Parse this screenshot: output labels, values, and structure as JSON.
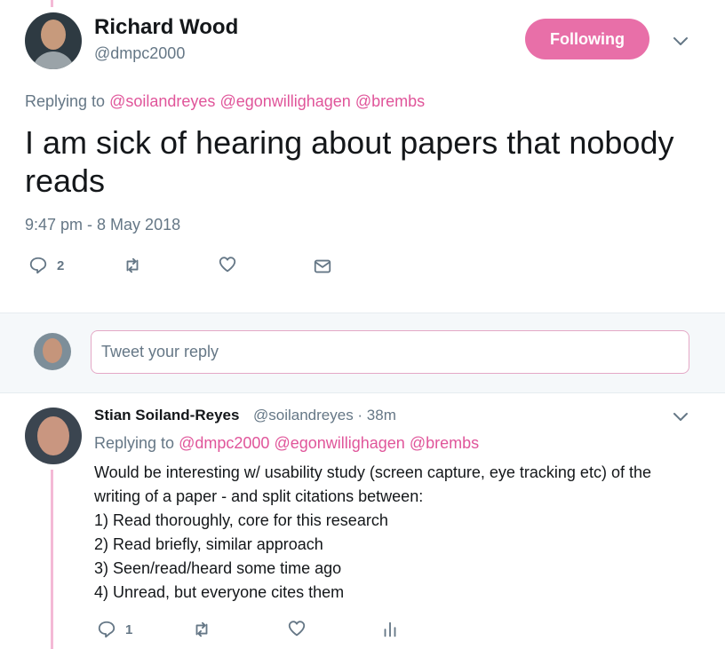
{
  "main_tweet": {
    "display_name": "Richard Wood",
    "handle": "@dmpc2000",
    "follow_label": "Following",
    "replying_prefix": "Replying to",
    "replying_mentions": [
      "@soilandreyes",
      "@egonwillighagen",
      "@brembs"
    ],
    "text": "I am sick of hearing about papers that nobody reads",
    "timestamp": "9:47 pm - 8 May 2018",
    "actions": {
      "reply_count": "2"
    }
  },
  "compose": {
    "placeholder": "Tweet your reply"
  },
  "reply_tweet": {
    "display_name": "Stian Soiland-Reyes",
    "meta": "@soilandreyes · 38m",
    "replying_prefix": "Replying to",
    "replying_mentions": [
      "@dmpc2000",
      "@egonwillighagen",
      "@brembs"
    ],
    "lines": [
      "Would be interesting w/ usability study (screen capture, eye tracking etc) of the",
      "writing of a paper - and split citations between:",
      "1) Read thoroughly, core for this research",
      "2) Read briefly, similar approach",
      "3) Seen/read/heard some time ago",
      "4) Unread, but everyone cites them"
    ],
    "actions": {
      "reply_count": "1"
    }
  },
  "colors": {
    "accent": "#e86fa8",
    "mention": "#e0559a",
    "muted": "#657786"
  },
  "icons": {
    "reply": "reply-icon",
    "retweet": "retweet-icon",
    "like": "heart-icon",
    "message": "envelope-icon",
    "analytics": "analytics-icon",
    "caret": "chevron-down-icon"
  }
}
